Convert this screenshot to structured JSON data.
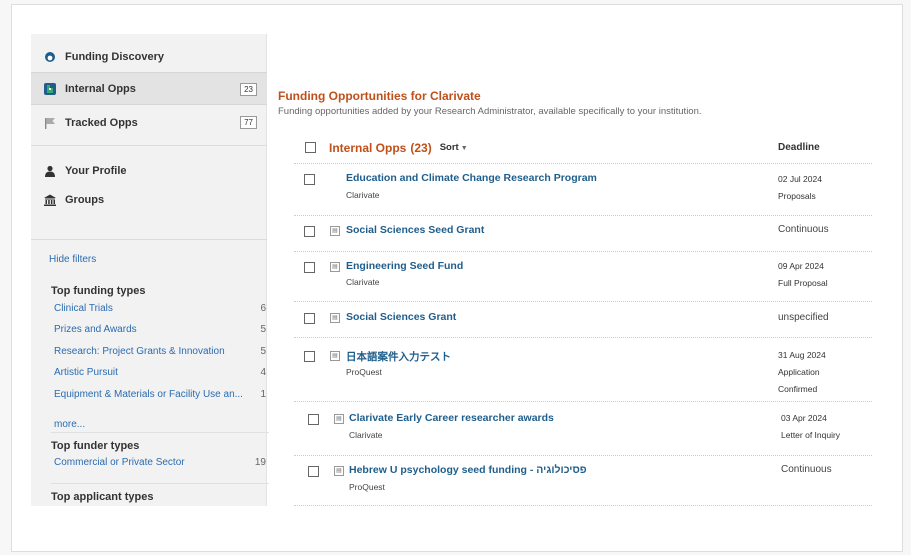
{
  "sidebar": {
    "nav": [
      {
        "label": "Funding Discovery",
        "icon": "funding-discovery-icon"
      },
      {
        "label": "Internal Opps",
        "icon": "internal-opps-icon",
        "badge": "23"
      },
      {
        "label": "Tracked Opps",
        "icon": "flag-icon",
        "badge": "77"
      }
    ],
    "profile": [
      {
        "label": "Your Profile",
        "icon": "person-icon"
      },
      {
        "label": "Groups",
        "icon": "building-icon"
      }
    ],
    "hide_filters": "Hide filters",
    "funding_types": {
      "heading": "Top funding types",
      "items": [
        {
          "label": "Clinical Trials",
          "count": "6"
        },
        {
          "label": "Prizes and Awards",
          "count": "5"
        },
        {
          "label": "Research: Project Grants & Innovation",
          "count": "5"
        },
        {
          "label": "Artistic Pursuit",
          "count": "4"
        },
        {
          "label": "Equipment & Materials or Facility Use an...",
          "count": "1"
        }
      ]
    },
    "more": "more...",
    "funder_types": {
      "heading": "Top funder types",
      "items": [
        {
          "label": "Commercial or Private Sector",
          "count": "19"
        }
      ]
    },
    "applicant_types": {
      "heading": "Top applicant types"
    }
  },
  "main": {
    "title": "Funding Opportunities for Clarivate",
    "subtitle": "Funding opportunities added by your Research Administrator, available specifically to your institution.",
    "list_title": "Internal Opps",
    "list_count": "(23)",
    "sort_label": "Sort",
    "deadline_label": "Deadline",
    "rows": [
      {
        "title": "Education and Climate Change Research Program",
        "org": "Clarivate",
        "deadline": [
          "02 Jul 2024",
          "Proposals"
        ],
        "doc": false
      },
      {
        "title": "Social Sciences Seed Grant",
        "org": "",
        "deadline": [
          "Continuous"
        ],
        "doc": true
      },
      {
        "title": "Engineering Seed Fund",
        "org": "Clarivate",
        "deadline": [
          "09 Apr 2024",
          "Full Proposal"
        ],
        "doc": true
      },
      {
        "title": "Social Sciences Grant",
        "org": "",
        "deadline": [
          "unspecified"
        ],
        "doc": true
      },
      {
        "title": "日本語案件入力テスト",
        "org": "ProQuest",
        "deadline": [
          "31 Aug 2024",
          "Application",
          "Confirmed"
        ],
        "doc": true
      },
      {
        "title": "Clarivate Early Career researcher awards",
        "org": "Clarivate",
        "deadline": [
          "03 Apr 2024",
          "Letter of Inquiry"
        ],
        "doc": true
      },
      {
        "title": "Hebrew U psychology seed funding - פסיכולוגיה",
        "org": "ProQuest",
        "deadline": [
          "Continuous"
        ],
        "doc": true
      }
    ]
  }
}
